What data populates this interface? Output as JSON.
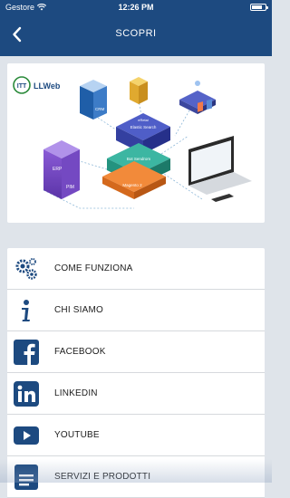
{
  "status_bar": {
    "carrier": "Gestore",
    "time": "12:26 PM",
    "battery_level": 0.8
  },
  "nav": {
    "title": "SCOPRI",
    "back_icon": "chevron-left-icon"
  },
  "hero": {
    "logo_text": "LLWeb",
    "box_labels": {
      "crm": "CRM",
      "pim": "PIM",
      "erp": "ERP",
      "elastic_search": "Elastic Search",
      "eretail": "eRetai",
      "magento": "Magento 2",
      "bot_sendrom": "Bot Sendrom"
    }
  },
  "menu": {
    "items": [
      {
        "label": "COME FUNZIONA",
        "icon": "gears-icon"
      },
      {
        "label": "CHI SIAMO",
        "icon": "info-icon"
      },
      {
        "label": "FACEBOOK",
        "icon": "facebook-icon"
      },
      {
        "label": "LINKEDIN",
        "icon": "linkedin-icon"
      },
      {
        "label": "YOUTUBE",
        "icon": "youtube-icon"
      },
      {
        "label": "SERVIZI E PRODOTTI",
        "icon": "document-icon"
      }
    ]
  },
  "colors": {
    "primary": "#1d4a80",
    "background": "#dfe4ea",
    "icon": "#1d4a80"
  }
}
